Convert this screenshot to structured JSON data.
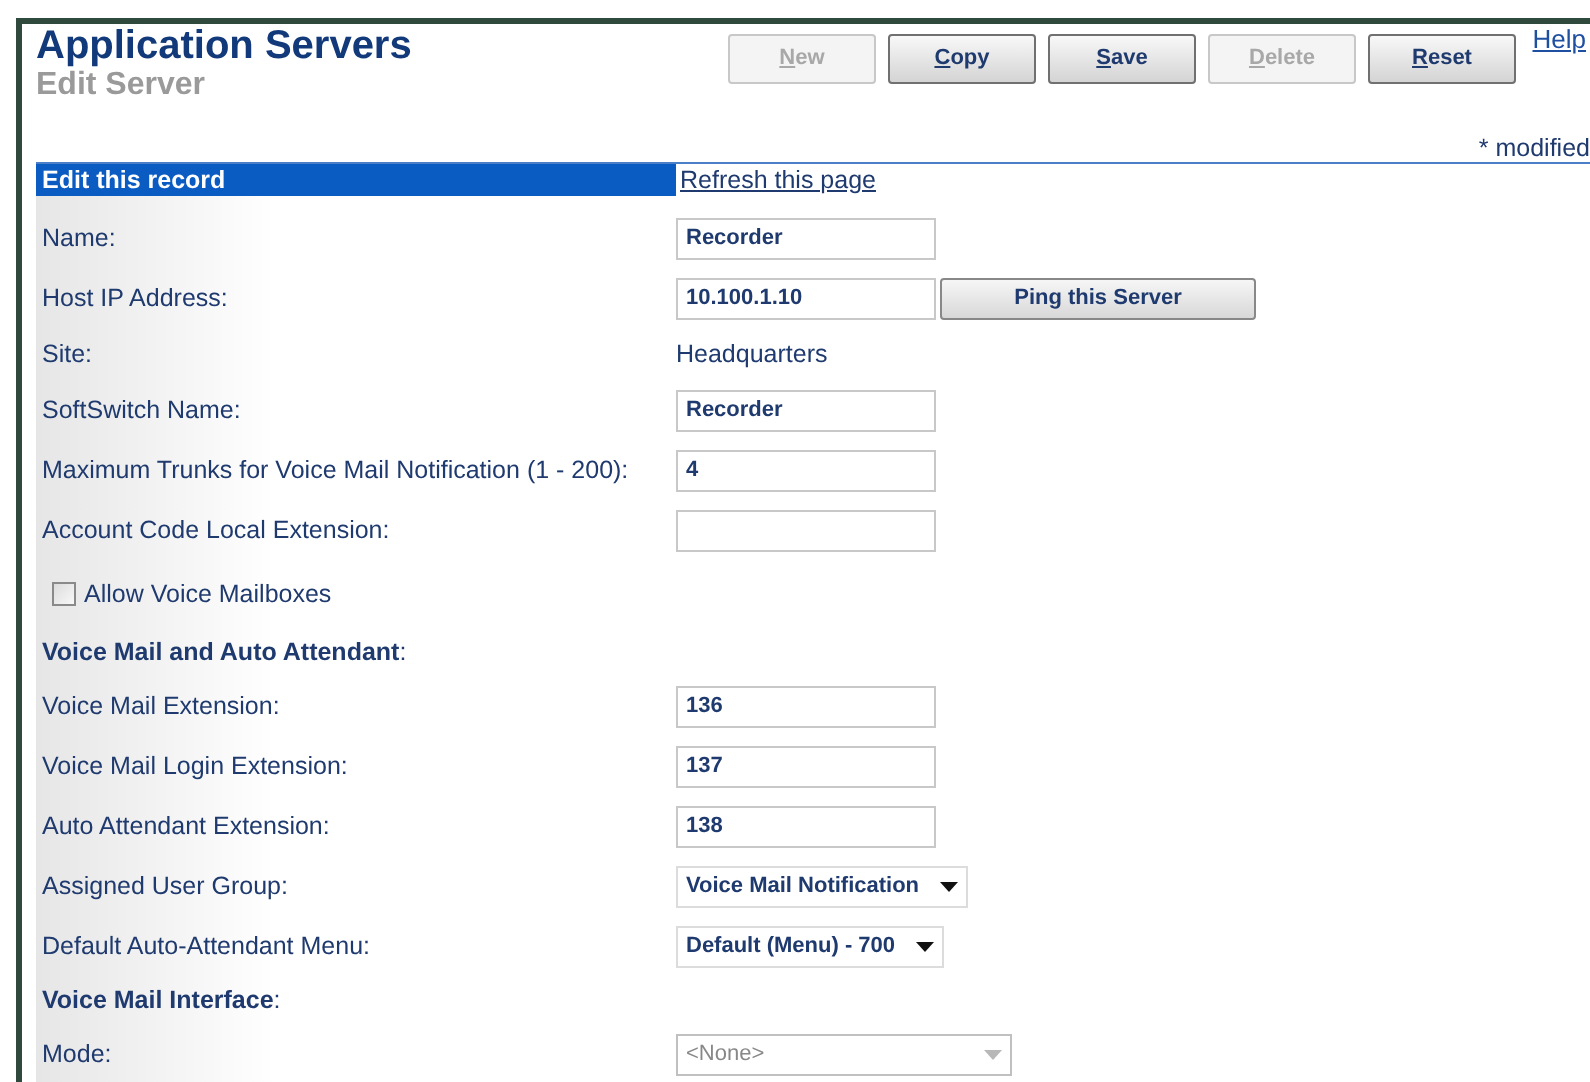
{
  "header": {
    "title": "Application Servers",
    "subtitle": "Edit Server"
  },
  "buttons": [
    {
      "label": "New",
      "disabled": true
    },
    {
      "label": "Copy",
      "disabled": false
    },
    {
      "label": "Save",
      "disabled": false
    },
    {
      "label": "Delete",
      "disabled": true
    },
    {
      "label": "Reset",
      "disabled": false
    }
  ],
  "help_link": "Help",
  "modified_note": "* modified",
  "section_bar": {
    "title": "Edit this record",
    "link": "Refresh this page"
  },
  "rows": [
    {
      "kind": "input",
      "label": "Name:",
      "value": "Recorder"
    },
    {
      "kind": "input",
      "label": "Host IP Address:",
      "value": "10.100.1.10",
      "button": "Ping this Server"
    },
    {
      "kind": "text",
      "label": "Site:",
      "value": "Headquarters"
    },
    {
      "kind": "input",
      "label": "SoftSwitch Name:",
      "value": "Recorder"
    },
    {
      "kind": "input",
      "label": "Maximum Trunks for Voice Mail Notification (1 - 200):",
      "value": "4"
    },
    {
      "kind": "input",
      "label": "Account Code Local Extension:"
    },
    {
      "kind": "checkbox",
      "label": "Allow Voice Mailboxes",
      "checked": false
    },
    {
      "kind": "heading",
      "label": "Voice Mail and Auto Attendant",
      "suffix": ":"
    },
    {
      "kind": "input",
      "label": "Voice Mail Extension:",
      "value": "136"
    },
    {
      "kind": "input",
      "label": "Voice Mail Login Extension:",
      "value": "137"
    },
    {
      "kind": "input",
      "label": "Auto Attendant Extension:",
      "value": "138"
    },
    {
      "kind": "select",
      "label": "Assigned User Group:",
      "value": "Voice Mail Notification",
      "disabled": false
    },
    {
      "kind": "select",
      "label": "Default Auto-Attendant Menu:",
      "value": "Default (Menu) - 700",
      "disabled": false
    },
    {
      "kind": "heading",
      "label": "Voice Mail Interface",
      "suffix": ":"
    },
    {
      "kind": "select",
      "label": "Mode:",
      "value": "<None>",
      "disabled": true
    }
  ]
}
